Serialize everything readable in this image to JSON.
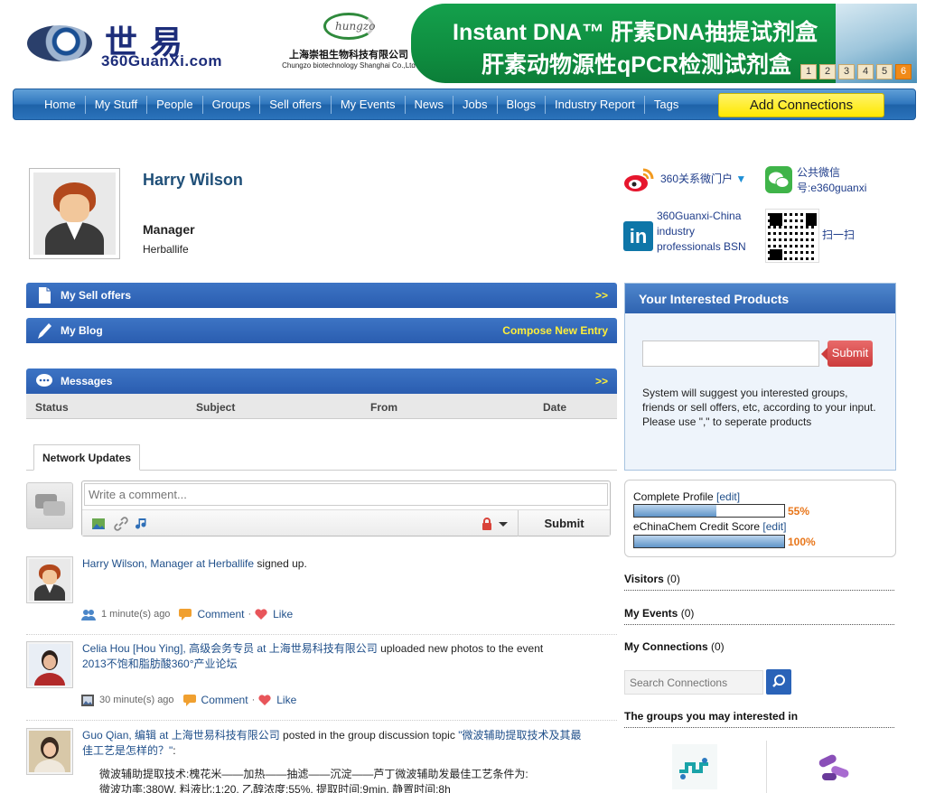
{
  "header": {
    "logo_cn": "世易",
    "logo_en": "360GuanXi.com",
    "sponsor": {
      "mark": "hungzo",
      "name_cn": "上海崇祖生物科技有限公司",
      "name_en": "Chungzo biotechnology Shanghai Co.,Ltd"
    },
    "banner": {
      "line1": "Instant DNA™ 肝素DNA抽提试剂盒",
      "line2": "肝素动物源性qPCR检测试剂盒",
      "pages": [
        "1",
        "2",
        "3",
        "4",
        "5",
        "6"
      ],
      "active_page": "6"
    }
  },
  "nav": {
    "items": [
      "Home",
      "My Stuff",
      "People",
      "Groups",
      "Sell offers",
      "My Events",
      "News",
      "Jobs",
      "Blogs",
      "Industry Report",
      "Tags"
    ],
    "add_connections": "Add Connections"
  },
  "profile": {
    "name": "Harry Wilson",
    "title": "Manager",
    "company": "Herballife"
  },
  "social": {
    "weibo": "360关系微门户",
    "wechat": "公共微信号:e360guanxi",
    "linkedin": "360Guanxi-China industry professionals BSN",
    "qr": "扫一扫"
  },
  "panels": {
    "sell_offers": {
      "title": "My Sell offers",
      "action": ">>"
    },
    "blog": {
      "title": "My Blog",
      "action": "Compose New Entry"
    },
    "messages": {
      "title": "Messages",
      "action": ">>",
      "columns": [
        "Status",
        "Subject",
        "From",
        "Date"
      ]
    }
  },
  "network_updates": {
    "tab": "Network Updates",
    "comment_placeholder": "Write a comment...",
    "submit": "Submit",
    "feed": [
      {
        "actor": "Harry Wilson, Manager at Herballife",
        "action": " signed up.",
        "target": "",
        "time": "1 minute(s) ago",
        "comment": "Comment",
        "like": "Like"
      },
      {
        "actor": "Celia Hou [Hou Ying], 高级会务专员 at 上海世易科技有限公司",
        "action": " uploaded new photos to the event ",
        "target": "2013不饱和脂肪酸360°产业论坛",
        "time": "30 minute(s) ago",
        "comment": "Comment",
        "like": "Like"
      },
      {
        "actor": "Guo Qian, 编辑 at 上海世易科技有限公司",
        "action": " posted in the group discussion topic ",
        "target": "\"微波辅助提取技术及其最佳工艺是怎样的？\"",
        "colon": ":",
        "excerpt1": "微波辅助提取技术:槐花米——加热——抽滤——沉淀——芦丁微波辅助发最佳工艺条件为:",
        "excerpt2": "微波功率:380W, 料液比:1:20, 乙醇浓度:55%, 提取时间:9min, 静置时间:8h"
      }
    ]
  },
  "sidebar": {
    "interested": {
      "title": "Your Interested Products",
      "submit": "Submit",
      "description": "System will suggest you interested groups, friends or sell offers, etc, according to your input. Please use \",\" to seperate products"
    },
    "complete_profile": {
      "label": "Complete Profile ",
      "edit": "[edit]",
      "percent_text": "55%",
      "percent": 55
    },
    "credit_score": {
      "label": "eChinaChem Credit Score ",
      "edit": "[edit]",
      "percent_text": "100%",
      "percent": 100
    },
    "visitors": {
      "label": "Visitors",
      "count": " (0)"
    },
    "events": {
      "label": "My Events",
      "count": " (0)"
    },
    "connections": {
      "label": "My Connections",
      "count": " (0)"
    },
    "search_placeholder": "Search Connections",
    "groups_title": "The groups you may interested in"
  },
  "colors": {
    "nav_blue": "#2e75bd",
    "panel_blue": "#2a5db0",
    "accent_yellow": "#ffe800",
    "banner_green": "#0f8e40",
    "percent_orange": "#e8761a",
    "link_blue": "#1f4f8a"
  }
}
